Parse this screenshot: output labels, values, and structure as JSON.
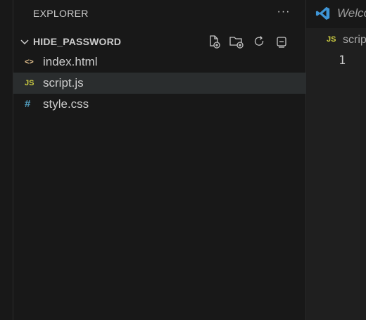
{
  "explorer": {
    "title": "EXPLORER",
    "more_label": "···",
    "folder": {
      "name": "HIDE_PASSWORD",
      "actions": [
        "new-file-icon",
        "new-folder-icon",
        "refresh-icon",
        "collapse-all-icon"
      ]
    },
    "files": [
      {
        "name": "index.html",
        "icon_text": "<>",
        "icon_color": "#e2c08d",
        "selected": false
      },
      {
        "name": "script.js",
        "icon_text": "JS",
        "icon_color": "#cbcb41",
        "selected": true
      },
      {
        "name": "style.css",
        "icon_text": "#",
        "icon_color": "#519aba",
        "selected": false
      }
    ]
  },
  "editor": {
    "tab_label": "Welcome",
    "breadcrumb_icon": "JS",
    "breadcrumb_text": "script.js",
    "line_numbers": [
      "1"
    ]
  },
  "colors": {
    "sidebar_bg": "#181818",
    "editor_bg": "#1f1f1f",
    "selected_row": "#2a2d2e",
    "vscode_blue": "#3e95d6",
    "js_yellow": "#cbcb41"
  }
}
